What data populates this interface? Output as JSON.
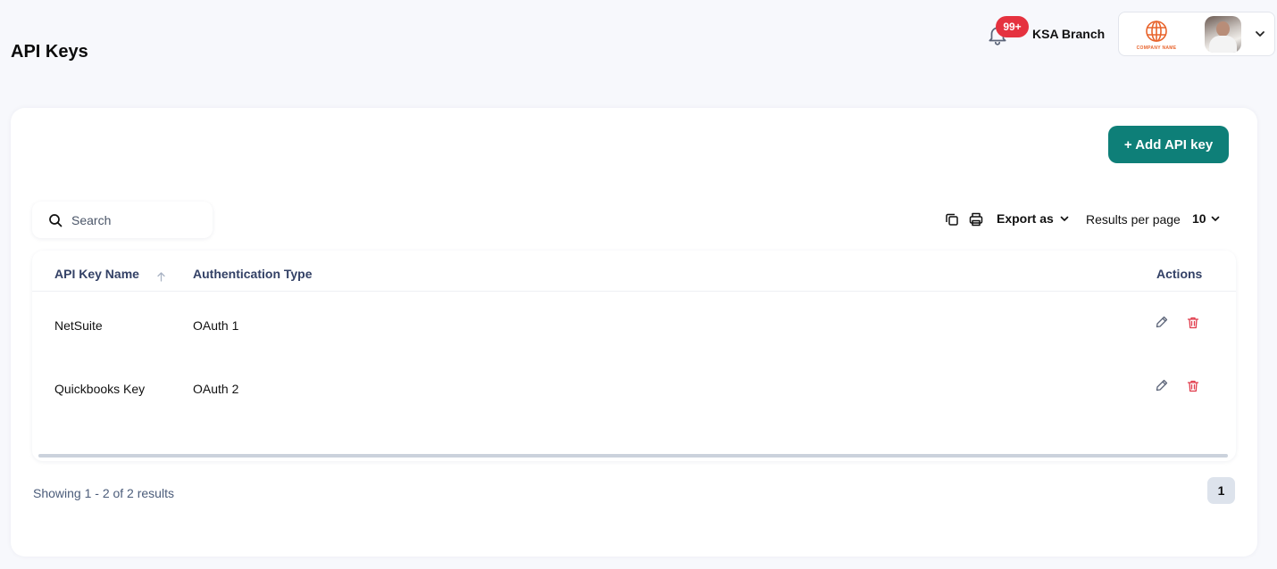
{
  "page": {
    "title": "API Keys"
  },
  "header": {
    "notification_badge": "99+",
    "branch": "KSA Branch",
    "company_logo_text": "COMPANY NAME"
  },
  "toolbar": {
    "add_label": "+ Add API key",
    "search_placeholder": "Search",
    "export_label": "Export as",
    "results_per_page_label": "Results per page",
    "results_per_page_value": "10"
  },
  "table": {
    "columns": [
      "API Key Name",
      "Authentication Type",
      "Actions"
    ],
    "rows": [
      {
        "name": "NetSuite",
        "auth_type": "OAuth 1"
      },
      {
        "name": "Quickbooks Key",
        "auth_type": "OAuth 2"
      }
    ]
  },
  "footer": {
    "showing": "Showing 1 - 2 of 2 results",
    "current_page": "1"
  },
  "colors": {
    "accent": "#0e7f78",
    "badge": "#e5323f",
    "delete": "#e03a4a"
  }
}
